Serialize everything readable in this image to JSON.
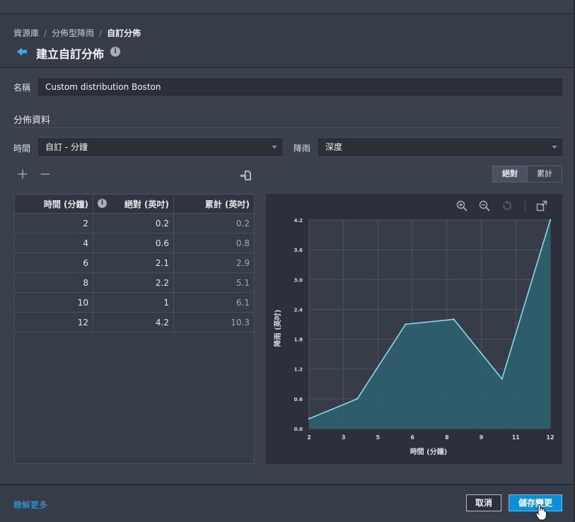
{
  "breadcrumb": [
    "資源庫",
    "分佈型降雨",
    "自訂分佈"
  ],
  "page_title": "建立自訂分佈",
  "name_label": "名稱",
  "name_value": "Custom distribution Boston",
  "section_title": "分佈資料",
  "time_label": "時間",
  "time_value": "自訂 - 分鐘",
  "rain_label": "降雨",
  "rain_value": "深度",
  "toggle": {
    "absolute": "絕對",
    "cumulative": "累計",
    "active": "absolute"
  },
  "table": {
    "headers": [
      "時間 (分鐘)",
      "絕對 (英吋)",
      "累計 (英吋)"
    ],
    "rows": [
      [
        "2",
        "0.2",
        "0.2"
      ],
      [
        "4",
        "0.6",
        "0.8"
      ],
      [
        "6",
        "2.1",
        "2.9"
      ],
      [
        "8",
        "2.2",
        "5.1"
      ],
      [
        "10",
        "1",
        "6.1"
      ],
      [
        "12",
        "4.2",
        "10.3"
      ]
    ]
  },
  "chart_data": {
    "type": "area",
    "xlabel": "時間 (分鐘)",
    "ylabel": "降雨 (英吋)",
    "x_ticks": [
      "2",
      "3",
      "5",
      "6",
      "8",
      "9",
      "11",
      "12"
    ],
    "y_ticks": [
      "0.0",
      "0.6",
      "1.2",
      "1.8",
      "2.4",
      "3.0",
      "3.6",
      "4.2"
    ],
    "ylim": [
      0,
      4.2
    ],
    "points": [
      [
        2,
        0.2
      ],
      [
        4,
        0.6
      ],
      [
        6,
        2.1
      ],
      [
        8,
        2.2
      ],
      [
        10,
        1
      ],
      [
        12,
        4.2
      ]
    ],
    "line_color": "#7fe0ea",
    "fill_color": "#2d6271",
    "grid": true
  },
  "footer": {
    "learn_more": "瞭解更多",
    "cancel": "取消",
    "save": "儲存變更"
  },
  "accent_color": "#0b8fd6"
}
